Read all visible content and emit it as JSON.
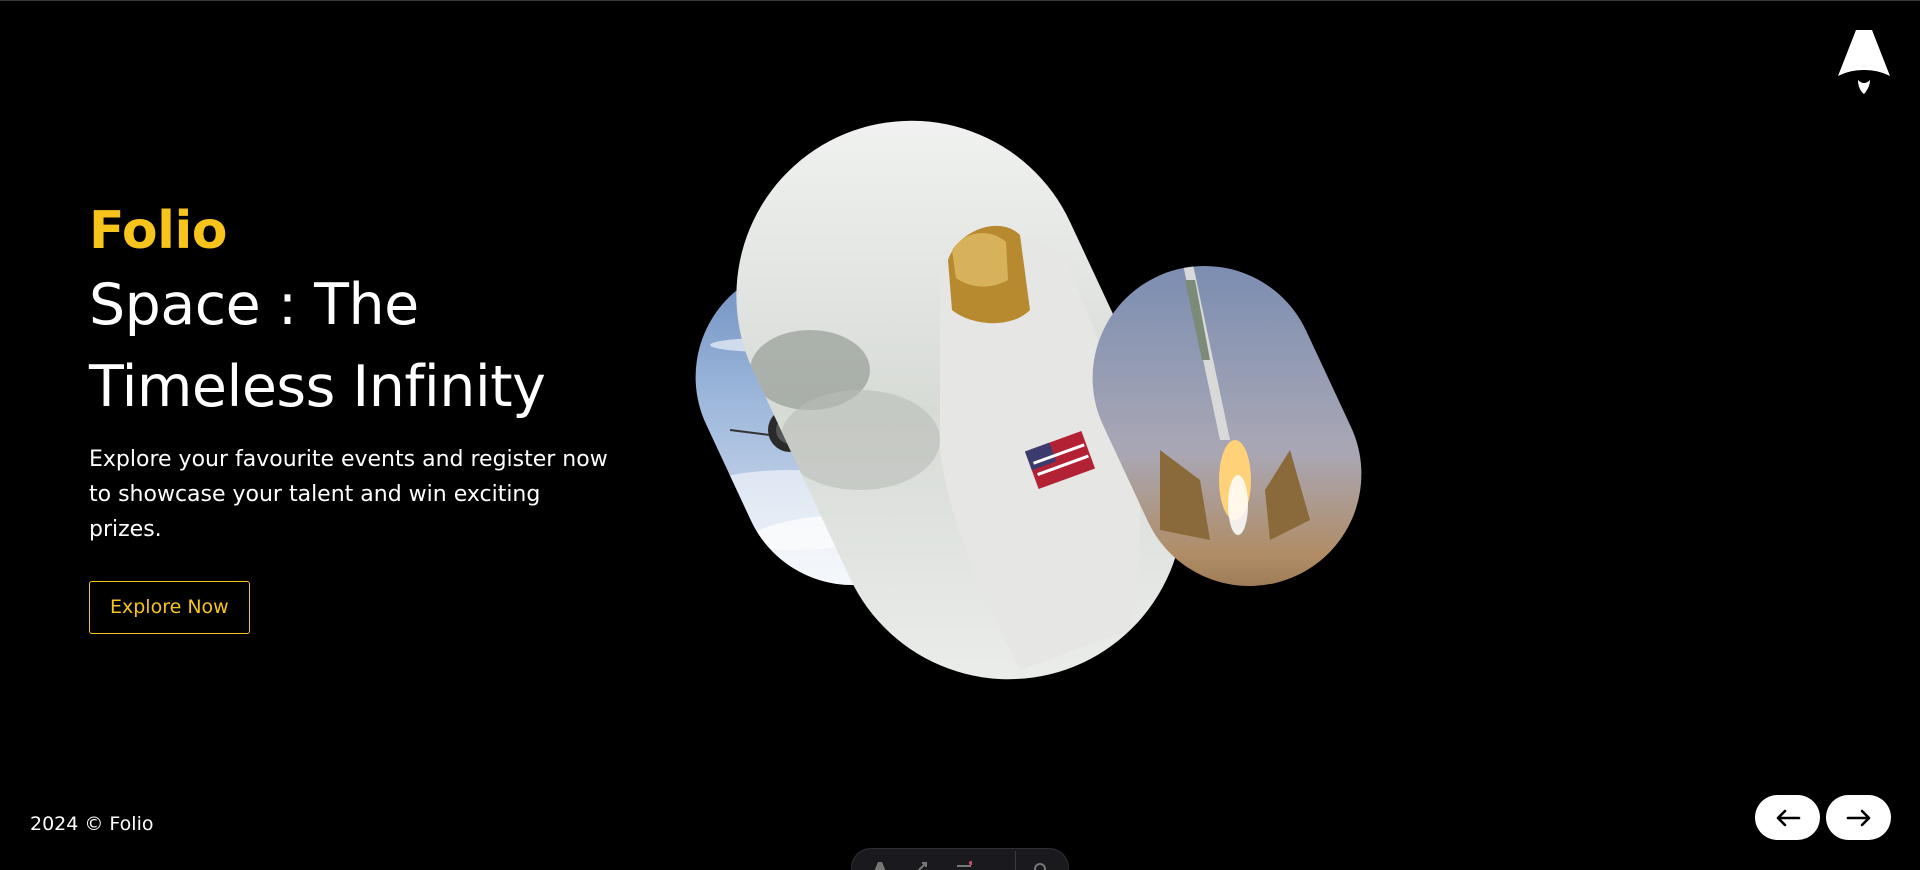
{
  "brand": "Folio",
  "hero": {
    "title_line1": "Space : The",
    "title_line2": "Timeless Infinity",
    "description": "Explore your favourite events and register now to showcase your talent and win exciting prizes.",
    "cta_label": "Explore Now"
  },
  "gallery": {
    "images": [
      {
        "subject": "spacecraft-over-clouds"
      },
      {
        "subject": "astronaut-portrait"
      },
      {
        "subject": "rocket-launch"
      }
    ]
  },
  "footer": {
    "copyright": "2024 © Folio"
  },
  "nav": {
    "prev_icon": "arrow-left-icon",
    "next_icon": "arrow-right-icon"
  },
  "colors": {
    "background": "#000000",
    "accent": "#f7c41c",
    "text": "#ffffff"
  }
}
